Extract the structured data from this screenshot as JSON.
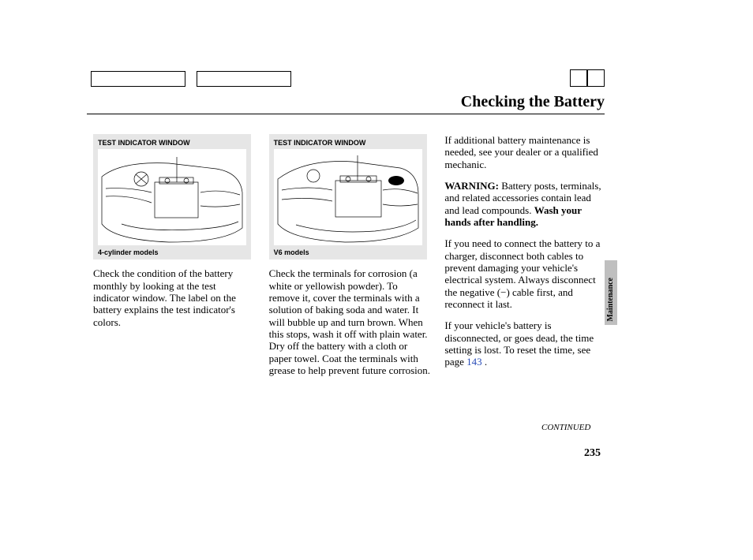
{
  "header": {
    "title": "Checking the Battery"
  },
  "figure1": {
    "label": "TEST INDICATOR WINDOW",
    "caption": "4-cylinder models"
  },
  "figure2": {
    "label": "TEST INDICATOR WINDOW",
    "caption": "V6 models"
  },
  "col1": {
    "p1": "Check the condition of the battery monthly by looking at the test indicator window. The label on the battery explains the test indicator's colors."
  },
  "col2": {
    "p1": "Check the terminals for corrosion (a white or yellowish powder). To remove it, cover the terminals with a solution of baking soda and water. It will bubble up and turn brown. When this stops, wash it off with plain water. Dry off the battery with a cloth or paper towel. Coat the terminals with grease to help prevent future corrosion."
  },
  "col3": {
    "p1": "If additional battery maintenance is needed, see your dealer or a qualified mechanic.",
    "warn_label": "WARNING:",
    "warn_text": " Battery posts, terminals, and related accessories contain lead and lead compounds. ",
    "warn_bold": "Wash your hands after handling.",
    "p3a": "If you need to connect the battery to a charger, disconnect both cables to prevent damaging your vehicle's electrical system. Always disconnect the negative (",
    "neg_symbol": "−",
    "p3b": ") cable first, and reconnect it last.",
    "p4a": "If your vehicle's battery is disconnected, or goes dead, the time setting is lost. To reset the time, see page ",
    "page_ref": "143",
    "p4b": " ."
  },
  "side_tab": "Maintenance",
  "continued": "CONTINUED",
  "page_number": "235"
}
